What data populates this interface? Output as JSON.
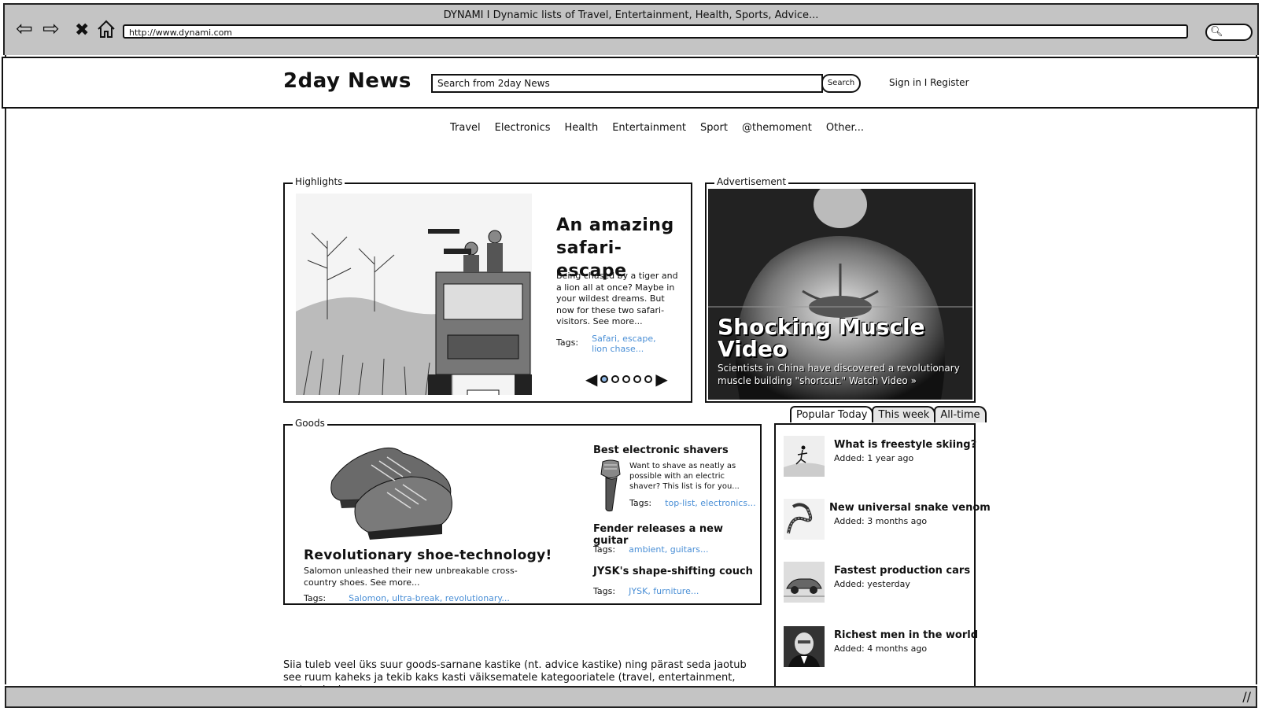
{
  "browser": {
    "title": "DYNAMI I Dynamic lists of Travel, Entertainment, Health, Sports, Advice...",
    "url": "http://www.dynami.com",
    "icons": [
      "back-arrow-icon",
      "forward-arrow-icon",
      "stop-icon",
      "home-icon",
      "search-icon"
    ]
  },
  "header": {
    "logo": "2day News",
    "search_placeholder": "Search from 2day News",
    "search_button": "Search",
    "auth": "Sign in I Register"
  },
  "nav": [
    "Travel",
    "Electronics",
    "Health",
    "Entertainment",
    "Sport",
    "@themoment",
    "Other..."
  ],
  "highlights": {
    "legend": "Highlights",
    "title": "An amazing safari-escape",
    "text": "Being chased by a tiger and a lion all at once? Maybe in your wildest dreams. But now for these two safari-visitors. See more...",
    "tags_label": "Tags:",
    "tags": "Safari, escape, lion chase...",
    "page_count": 5,
    "active_page": 1
  },
  "ad": {
    "legend": "Advertisement",
    "title": "Shocking Muscle Video",
    "text": "Scientists in China have discovered a revolutionary muscle building \"shortcut.\" Watch Video »"
  },
  "goods": {
    "legend": "Goods",
    "main": {
      "title": "Revolutionary shoe-technology!",
      "text": "Salomon unleashed their new unbreakable cross-country shoes. See more...",
      "tags_label": "Tags:",
      "tags": "Salomon, ultra-break, revolutionary..."
    },
    "items": [
      {
        "title": "Best electronic shavers",
        "text": "Want to shave as neatly as possible with an electric shaver? This list is for you...",
        "tags_label": "Tags:",
        "tags": "top-list, electronics..."
      },
      {
        "title": "Fender releases a new guitar",
        "tags_label": "Tags:",
        "tags": "ambient, guitars..."
      },
      {
        "title": "JYSK's shape-shifting couch",
        "tags_label": "Tags:",
        "tags": "JYSK, furniture..."
      }
    ]
  },
  "popular": {
    "tabs": [
      "Popular Today",
      "This week",
      "All-time"
    ],
    "active_tab": 0,
    "items": [
      {
        "title": "What is freestyle skiing?",
        "date": "Added: 1 year ago"
      },
      {
        "title": "New universal snake venom",
        "date": "Added: 3 months ago"
      },
      {
        "title": "Fastest production cars",
        "date": "Added: yesterday"
      },
      {
        "title": "Richest men in the world",
        "date": "Added: 4 months ago"
      }
    ]
  },
  "footer_note": "Siia tuleb veel üks suur goods-sarnane kastike (nt. advice kastike) ning pärast seda jaotub see ruum kaheks ja tekib kaks kasti väiksematele kategooriatele (travel, entertainment, motors jne)"
}
